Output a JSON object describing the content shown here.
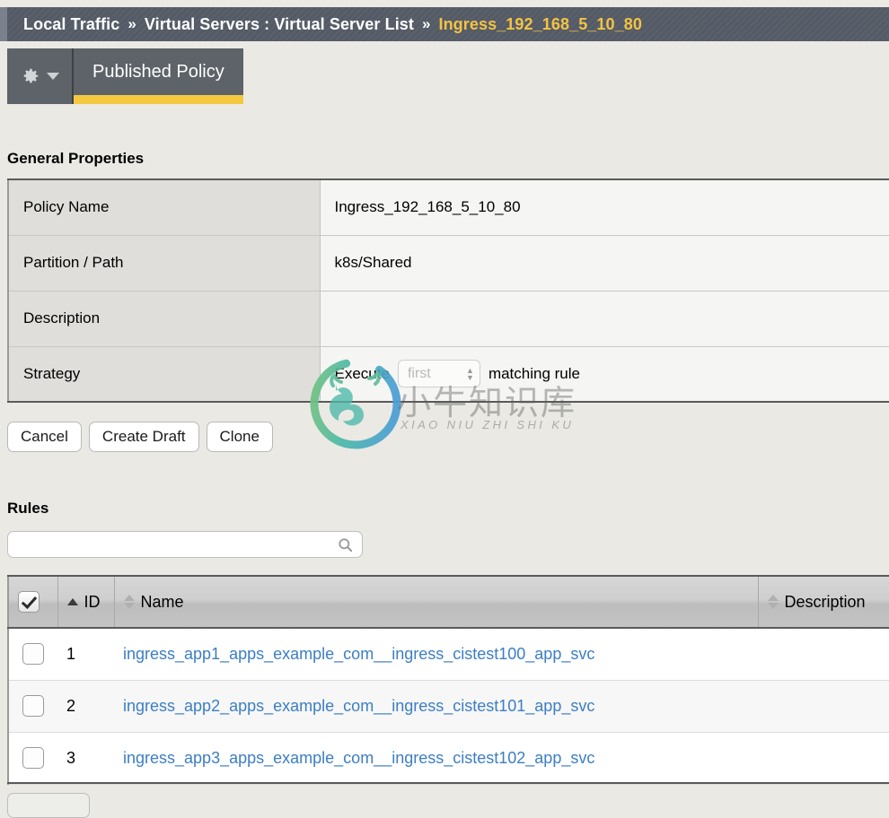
{
  "breadcrumb": {
    "separator": "»",
    "items": [
      {
        "label": "Local Traffic",
        "current": false
      },
      {
        "label": "Virtual Servers : Virtual Server List",
        "current": false
      },
      {
        "label": "Ingress_192_168_5_10_80",
        "current": true
      }
    ]
  },
  "tabs": {
    "gear_icon": "gear-icon",
    "dropdown_icon": "chevron-down-icon",
    "active_tab": "Published Policy",
    "accent_color": "#f5c93f"
  },
  "general_properties": {
    "title": "General Properties",
    "rows": [
      {
        "label": "Policy Name",
        "value": "Ingress_192_168_5_10_80"
      },
      {
        "label": "Partition / Path",
        "value": "k8s/Shared"
      },
      {
        "label": "Description",
        "value": ""
      }
    ],
    "strategy": {
      "label": "Strategy",
      "prefix": "Execute",
      "value": "first",
      "suffix": "matching rule",
      "stepper_up_icon": "chevron-up-icon",
      "stepper_down_icon": "chevron-down-icon"
    }
  },
  "buttons": [
    {
      "label": "Cancel",
      "name": "cancel-button"
    },
    {
      "label": "Create Draft",
      "name": "create-draft-button"
    },
    {
      "label": "Clone",
      "name": "clone-button"
    }
  ],
  "rules": {
    "title": "Rules",
    "search": {
      "value": "",
      "placeholder": "",
      "icon": "search-icon"
    },
    "columns": [
      {
        "key": "check",
        "label": "",
        "sort": "none"
      },
      {
        "key": "id",
        "label": "ID",
        "sort": "asc"
      },
      {
        "key": "name",
        "label": "Name",
        "sort": "both"
      },
      {
        "key": "description",
        "label": "Description",
        "sort": "both"
      }
    ],
    "header_checkbox_checked": true,
    "rows": [
      {
        "checked": false,
        "id": "1",
        "name": "ingress_app1_apps_example_com__ingress_cistest100_app_svc",
        "description": ""
      },
      {
        "checked": false,
        "id": "2",
        "name": "ingress_app2_apps_example_com__ingress_cistest101_app_svc",
        "description": ""
      },
      {
        "checked": false,
        "id": "3",
        "name": "ingress_app3_apps_example_com__ingress_cistest102_app_svc",
        "description": ""
      }
    ],
    "link_color": "#3c7ec4"
  },
  "watermark": {
    "text_cn": "小牛知识库",
    "text_en": "XIAO NIU ZHI SHI KU"
  }
}
